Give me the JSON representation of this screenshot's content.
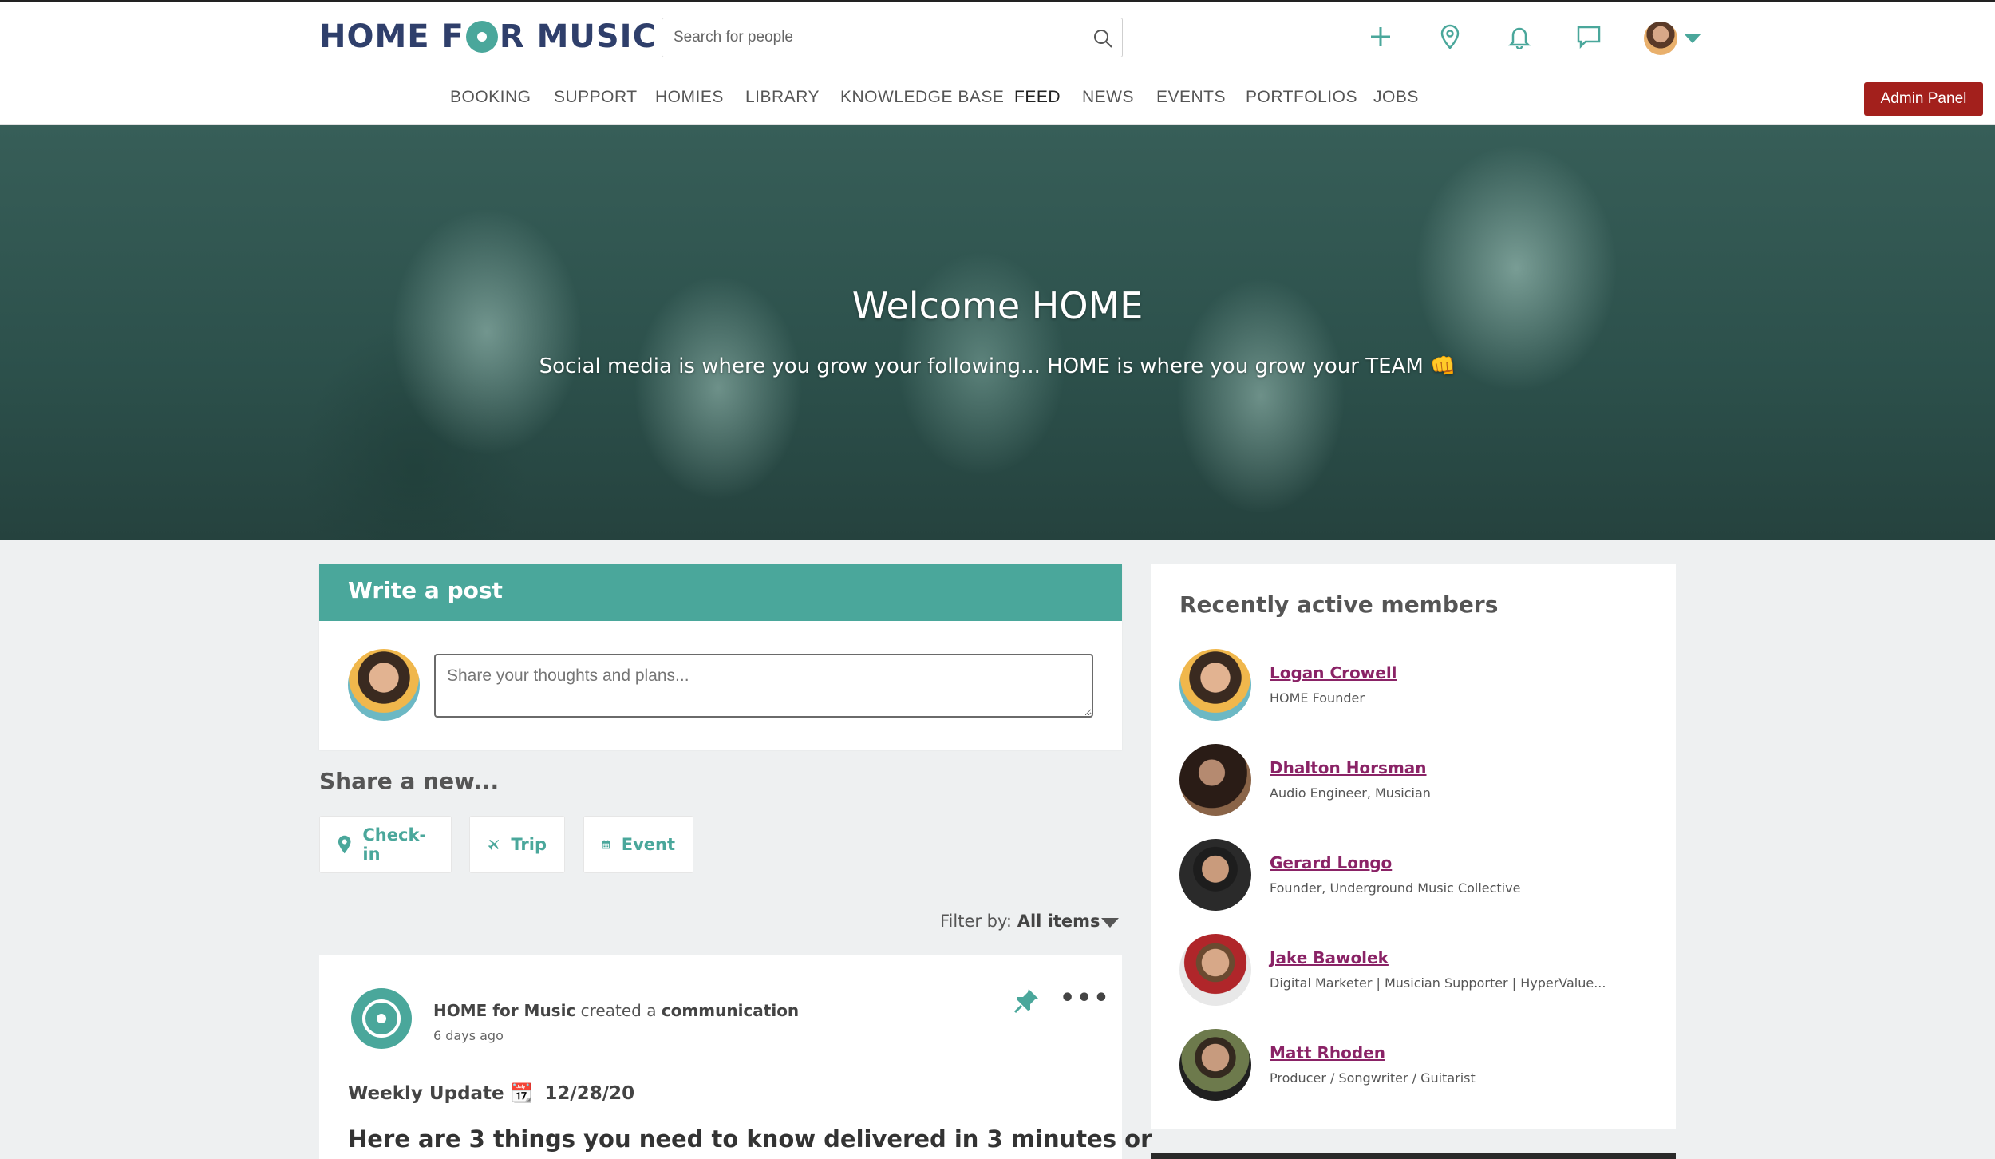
{
  "header": {
    "logo_text": "HOME F●R MUSIC",
    "logo_left": "HOME F",
    "logo_right": "R MUSIC",
    "search_placeholder": "Search for people",
    "icons": [
      "plus-icon",
      "map-pin-icon",
      "bell-icon",
      "chat-icon",
      "search-icon",
      "chevron-down-icon"
    ]
  },
  "nav": {
    "items": [
      "BOOKING",
      "SUPPORT",
      "HOMIES",
      "LIBRARY",
      "KNOWLEDGE BASE",
      "FEED",
      "NEWS",
      "EVENTS",
      "PORTFOLIOS",
      "JOBS"
    ],
    "active": "FEED",
    "admin_label": "Admin Panel"
  },
  "hero": {
    "title": "Welcome HOME",
    "subtitle": "Social media is where you grow your following... HOME is where you grow your TEAM 👊"
  },
  "write_post": {
    "title": "Write a post",
    "placeholder": "Share your thoughts and plans..."
  },
  "share": {
    "title": "Share a new...",
    "buttons": [
      {
        "label": "Check-in",
        "icon": "map-pin-icon"
      },
      {
        "label": "Trip",
        "icon": "plane-icon"
      },
      {
        "label": "Event",
        "icon": "calendar-icon"
      }
    ]
  },
  "filter": {
    "label": "Filter by:",
    "value": "All items"
  },
  "post": {
    "author": "HOME for Music",
    "action": "created a",
    "object": "communication",
    "time": "6 days ago",
    "subtitle_prefix": "Weekly Update 📆",
    "subtitle_date": "12/28/20",
    "headline": "Here are 3 things you need to know delivered in 3 minutes or"
  },
  "members": {
    "title": "Recently active members",
    "list": [
      {
        "name": "Logan Crowell",
        "role": "HOME Founder"
      },
      {
        "name": "Dhalton Horsman",
        "role": "Audio Engineer, Musician"
      },
      {
        "name": "Gerard Longo",
        "role": "Founder, Underground Music Collective"
      },
      {
        "name": "Jake Bawolek",
        "role": "Digital Marketer | Musician Supporter | HyperValue..."
      },
      {
        "name": "Matt Rhoden",
        "role": "Producer / Songwriter / Guitarist"
      }
    ]
  },
  "colors": {
    "brand_navy": "#2f3f6b",
    "accent_teal": "#4aa79b",
    "admin_red": "#a3201c",
    "member_link": "#8a2366"
  }
}
